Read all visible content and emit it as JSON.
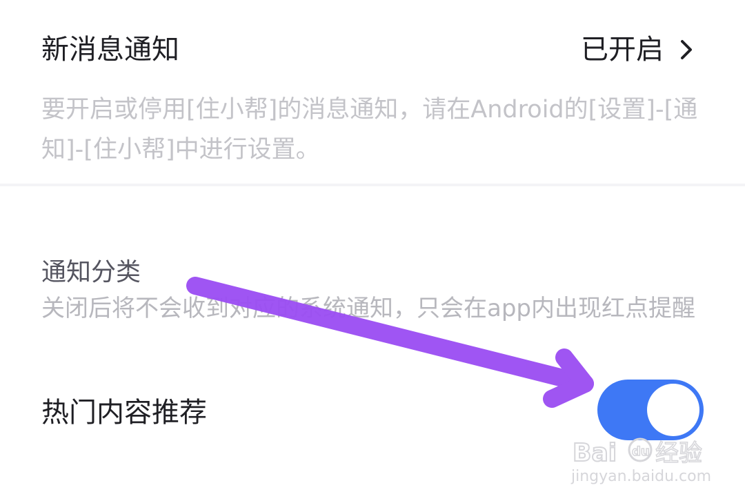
{
  "notification": {
    "title": "新消息通知",
    "status": "已开启",
    "description": "要开启或停用[住小帮]的消息通知，请在Android的[设置]-[通知]-[住小帮]中进行设置。"
  },
  "category": {
    "title": "通知分类",
    "description": "关闭后将不会收到对应的系统通知，只会在app内出现红点提醒"
  },
  "hot_content": {
    "label": "热门内容推荐",
    "toggle_on": true
  },
  "colors": {
    "accent": "#3e78f5",
    "arrow": "#9a4cf2",
    "text_primary": "#1f1f24",
    "text_secondary": "#c3c3c8"
  },
  "watermark": {
    "logo_text": "Baidu经验",
    "url": "jingyan.baidu.com"
  }
}
